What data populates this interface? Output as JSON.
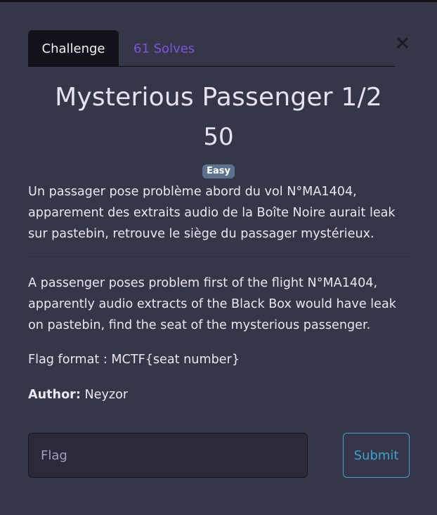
{
  "tabs": {
    "challenge_label": "Challenge",
    "solves_label": "61 Solves"
  },
  "close_icon": "close-icon",
  "challenge": {
    "title": "Mysterious Passenger 1/2",
    "points": "50",
    "difficulty": "Easy"
  },
  "description": {
    "fr": "Un passager pose problème abord du vol N°MA1404, apparement des extraits audio de la Boîte Noire aurait leak sur pastebin, retrouve le siège du passager mystérieux.",
    "en": "A passenger poses problem first of the flight N°MA1404, apparently audio extracts of the Black Box would have leak on pastebin, find the seat of the mysterious passenger.",
    "flag_format": "Flag format : MCTF{seat number}",
    "author_label": "Author:",
    "author_name": "Neyzor"
  },
  "form": {
    "flag_placeholder": "Flag",
    "flag_value": "",
    "submit_label": "Submit"
  },
  "colors": {
    "background": "#363649",
    "active_tab": "#12121b",
    "solves_link": "#7a55e0",
    "badge": "#5c7390",
    "submit_accent": "#3ba4cf"
  }
}
